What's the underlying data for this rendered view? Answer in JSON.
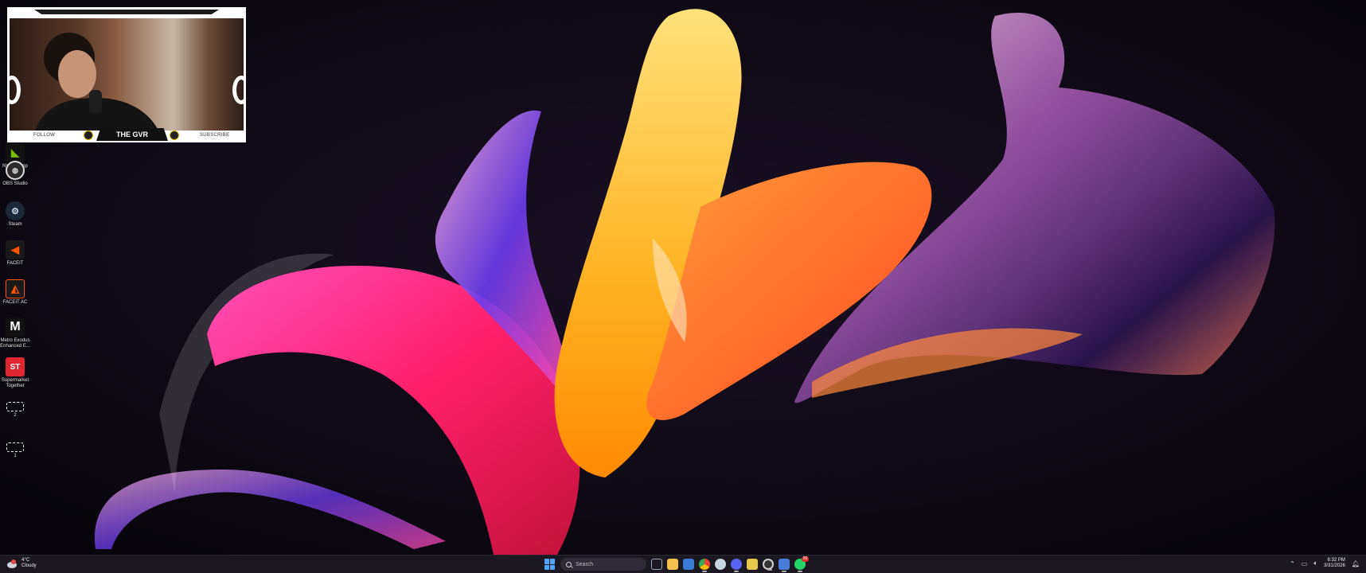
{
  "webcam": {
    "follow": "FOLLOW",
    "name": "THE GVR",
    "subscribe": "SUBSCRIBE"
  },
  "desktop_icons": [
    {
      "label": "NVIDIA App",
      "icon": "nvidia-icon",
      "color": "#76b900"
    },
    {
      "label": "OBS Studio",
      "icon": "obs-icon",
      "color": "#2b2b2b"
    },
    {
      "label": "Steam",
      "icon": "steam-icon",
      "color": "#1b2838"
    },
    {
      "label": "FACEIT",
      "icon": "faceit-icon",
      "color": "#ff5500"
    },
    {
      "label": "FACEIT AC",
      "icon": "faceit-ac-icon",
      "color": "#ff5500"
    },
    {
      "label": "Metro Exodus Enhanced E...",
      "icon": "metro-exodus-icon",
      "color": "#ffffff"
    },
    {
      "label": "Supermarket Together",
      "icon": "supermarket-together-icon",
      "color": "#e0262e"
    },
    {
      "label": "2",
      "icon": "shortcut-icon",
      "color": "#ffffff"
    },
    {
      "label": "1",
      "icon": "shortcut-icon",
      "color": "#ffffff"
    }
  ],
  "taskbar": {
    "weather": {
      "temp": "4°C",
      "condition": "Cloudy",
      "icon": "cloud-icon"
    },
    "search_placeholder": "Search",
    "apps": [
      {
        "icon": "task-view-icon",
        "color": "#9aa3b5",
        "active": false
      },
      {
        "icon": "file-explorer-icon",
        "color": "#f2c14e",
        "active": false
      },
      {
        "icon": "microsoft-store-icon",
        "color": "#3a7bd5",
        "active": false
      },
      {
        "icon": "chrome-icon",
        "color": "#34a853",
        "active": true
      },
      {
        "icon": "steam-taskbar-icon",
        "color": "#c7d5e0",
        "active": false
      },
      {
        "icon": "discord-icon",
        "color": "#5865f2",
        "active": true
      },
      {
        "icon": "terminal-icon",
        "color": "#e6c84f",
        "active": false
      },
      {
        "icon": "obs-taskbar-icon",
        "color": "#d0d0d0",
        "active": true
      },
      {
        "icon": "snipping-tool-icon",
        "color": "#4a7bd8",
        "active": true
      },
      {
        "icon": "whatsapp-icon",
        "color": "#25d366",
        "active": true,
        "badge": "99"
      }
    ],
    "clock": {
      "time": "6:32 PM",
      "date": "3/31/2026"
    }
  }
}
